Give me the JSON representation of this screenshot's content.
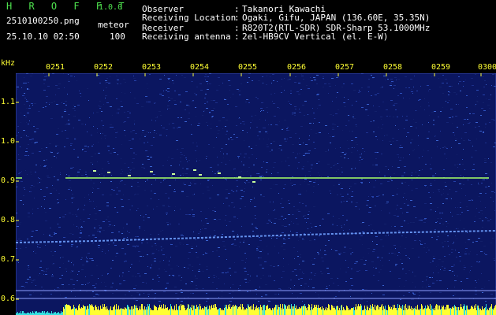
{
  "app": {
    "title": "H R O F F T",
    "version": "1.0.0"
  },
  "file": {
    "name": "2510100250.png",
    "datetime": "25.10.10 02:50",
    "counter_label": "meteor",
    "counter_value": "100"
  },
  "info": [
    {
      "label": "Observer",
      "sep": ":",
      "value": "Takanori Kawachi"
    },
    {
      "label": "Receiving Location",
      "sep": ":",
      "value": "Ogaki, Gifu, JAPAN (136.60E, 35.35N)"
    },
    {
      "label": "Receiver",
      "sep": ":",
      "value": "R820T2(RTL-SDR) SDR-Sharp 53.1000MHz"
    },
    {
      "label": "Receiving antenna",
      "sep": ":",
      "value": "2el-HB9CV Vertical (el. E-W)"
    }
  ],
  "axis": {
    "unit_label": "kHz",
    "y_ticks": [
      "1.1",
      "1.0",
      "0.9",
      "0.8",
      "0.7",
      "0.6"
    ],
    "time_labels": [
      "0251",
      "0252",
      "0253",
      "0254",
      "0255",
      "0256",
      "0257",
      "0258",
      "0259",
      "0300"
    ]
  },
  "colors": {
    "background": "#000000",
    "plot_background": "#0b1660",
    "header_green": "#4fe34f",
    "tick_yellow": "#ffff33",
    "signal_line": "#a8ff66",
    "meteor_trail": "#6ea0ff"
  }
}
